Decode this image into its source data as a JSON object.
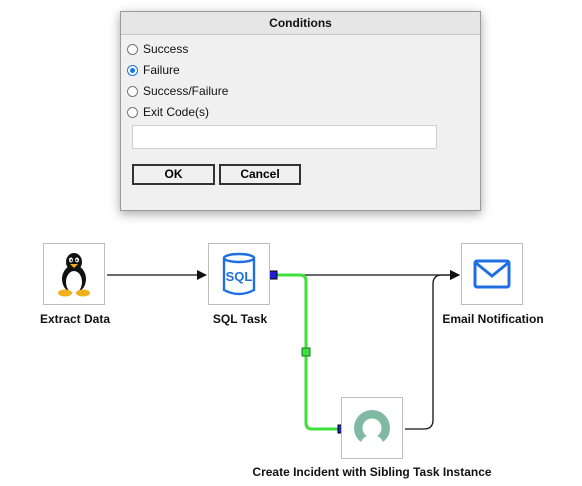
{
  "dialog": {
    "title": "Conditions",
    "options": [
      {
        "label": "Success",
        "checked": false
      },
      {
        "label": "Failure",
        "checked": true
      },
      {
        "label": "Success/Failure",
        "checked": false
      },
      {
        "label": "Exit Code(s)",
        "checked": false
      }
    ],
    "exit_code_value": "",
    "ok_label": "OK",
    "cancel_label": "Cancel"
  },
  "workflow": {
    "nodes": {
      "extract": {
        "label": "Extract Data",
        "icon": "linux-tux-icon"
      },
      "sql": {
        "label": "SQL Task",
        "icon": "sql-icon"
      },
      "email": {
        "label": "Email Notification",
        "icon": "envelope-icon"
      },
      "incident": {
        "label": "Create Incident with Sibling Task Instance",
        "icon": "servicenow-icon"
      }
    },
    "colors": {
      "accent_blue": "#1f6fe0",
      "failure_edge": "#3de03d",
      "port": "#2020d0",
      "incident_icon": "#7fb9a4"
    }
  }
}
